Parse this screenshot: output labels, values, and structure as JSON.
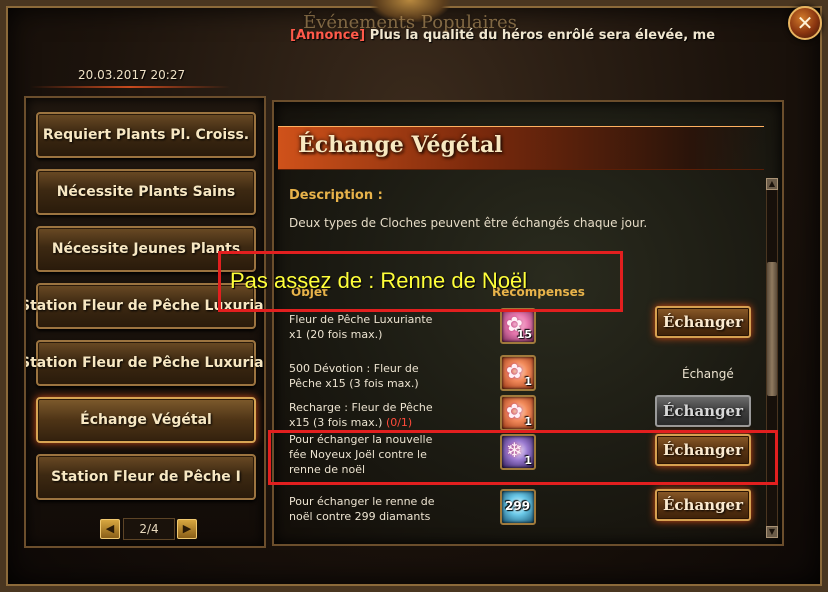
{
  "window": {
    "title": "Événements Populaires",
    "close_label": "✕"
  },
  "announcement": {
    "tag": "[Annonce]",
    "text": " Plus la qualité du héros enrôlé sera élevée, me"
  },
  "datetime": "20.03.2017 20:27",
  "sidebar": {
    "items": [
      {
        "label": "Requiert Plants Pl. Croiss."
      },
      {
        "label": "Nécessite Plants Sains"
      },
      {
        "label": "Nécessite Jeunes Plants"
      },
      {
        "label": "Station Fleur de Pêche Luxuriante"
      },
      {
        "label": "Station Fleur de Pêche Luxuriante"
      },
      {
        "label": "Échange Végétal"
      },
      {
        "label": "Station Fleur de Pêche I"
      }
    ],
    "pager": {
      "prev": "◀",
      "page": "2/4",
      "next": "▶"
    }
  },
  "main": {
    "title": "Échange Végétal",
    "description_label": "Description :",
    "description_text": "Deux types de Cloches peuvent être échangés chaque jour.",
    "columns": {
      "objet": "Objet",
      "recompenses": "Récompenses"
    },
    "rows": [
      {
        "line1": "Fleur de Pêche Luxuriante",
        "line2": "x1 (20 fois max.)",
        "line3": "",
        "suffix": "",
        "reward_count": "15",
        "button": "Échanger"
      },
      {
        "line1": "500 Dévotion : Fleur de",
        "line2": "Pêche x15 (3 fois max.)",
        "line3": "",
        "suffix": "",
        "reward_count": "1",
        "status": "Échangé"
      },
      {
        "line1": "Recharge : Fleur de Pêche",
        "line2": "x15 (3 fois max.) ",
        "line3": "",
        "suffix": "(0/1)",
        "reward_count": "1",
        "button": "Échanger"
      },
      {
        "line1": "Pour échanger la nouvelle",
        "line2": "fée Noyeux Joël contre le",
        "line3": "renne de noël",
        "suffix": "",
        "reward_count": "1",
        "button": "Échanger"
      },
      {
        "line1": "Pour échanger le renne de",
        "line2": "noël contre 299 diamants",
        "line3": "",
        "suffix": "",
        "reward_count": "299",
        "button": "Échanger"
      }
    ]
  },
  "annotation": {
    "text": "Pas assez de : Renne de Noël",
    "color": "#e21f1f",
    "text_color": "#ffff3a"
  },
  "colors": {
    "accent": "#e8b34a",
    "header": "#d0521a",
    "warning": "#ff4a3a"
  },
  "icons": {
    "reward_1": "peach-blossom-icon",
    "reward_2": "peach-blossom-icon",
    "reward_3": "peach-blossom-icon",
    "reward_4": "fairy-icon",
    "reward_5": "diamond-icon"
  }
}
